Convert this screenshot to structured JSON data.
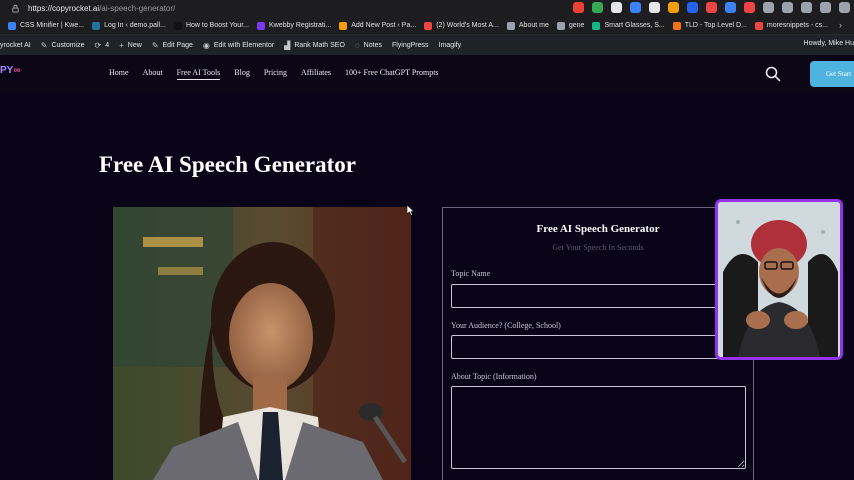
{
  "browser": {
    "url_host": "https://copyrocket.ai",
    "url_path": "/ai-speech-generator/"
  },
  "bookmarks": [
    {
      "label": "CSS Minifier | Kwe...",
      "color": "#3b82f6"
    },
    {
      "label": "Log In ‹ demo.pall...",
      "color": "#21759b"
    },
    {
      "label": "How to Boost Your...",
      "color": "#111111"
    },
    {
      "label": "Kwebby Registrati...",
      "color": "#7c3aed"
    },
    {
      "label": "Add New Post ‹ Pa...",
      "color": "#f59e0b"
    },
    {
      "label": "(2) World's Most A...",
      "color": "#ef4444"
    },
    {
      "label": "About me",
      "color": "#9ca3af"
    },
    {
      "label": "gene",
      "color": "#9ca3af"
    },
    {
      "label": "Smart Glasses, S...",
      "color": "#10b981"
    },
    {
      "label": "TLD - Top Level D...",
      "color": "#f97316"
    },
    {
      "label": "moresnippets - cs...",
      "color": "#ef4444"
    }
  ],
  "adminbar": {
    "site": "yrocket AI",
    "customize": "Customize",
    "updates": "4",
    "new": "New",
    "edit_page": "Edit Page",
    "elementor": "Edit with Elementor",
    "rankmath": "Rank Math SEO",
    "notes": "Notes",
    "flyingpress": "FlyingPress",
    "imagify": "Imagify",
    "howdy": "Howdy, Mike Hu"
  },
  "header": {
    "logo": "PY",
    "nav": [
      "Home",
      "About",
      "Free AI Tools",
      "Blog",
      "Pricing",
      "Affiliates",
      "100+ Free ChatGPT Prompts"
    ],
    "active_nav": "Free AI Tools",
    "cta": "Get Start"
  },
  "main": {
    "page_title": "Free AI Speech Generator",
    "form": {
      "title": "Free AI Speech Generator",
      "subtitle": "Get Your Speech In Seconds",
      "fields": [
        {
          "label": "Topic Name",
          "placeholder": ""
        },
        {
          "label": "Your Audience? (College, School)",
          "placeholder": ""
        },
        {
          "label": "About Topic (Information)",
          "placeholder": ""
        }
      ]
    }
  },
  "colors": {
    "page_bg": "#0a0418",
    "accent": "#4fb3e0",
    "webcam_border": "#9333ea"
  }
}
